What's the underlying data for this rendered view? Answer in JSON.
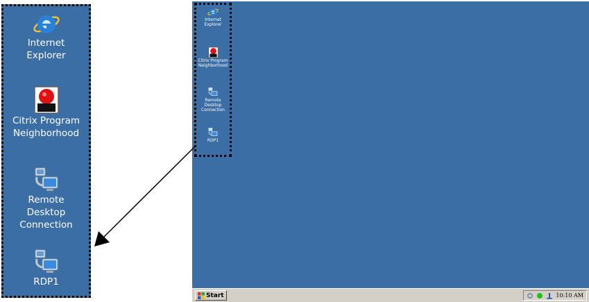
{
  "desktop_icons": [
    {
      "label_lines": [
        "Internet",
        "Explorer"
      ],
      "icon": "internet-explorer-icon"
    },
    {
      "label_lines": [
        "Citrix Program",
        "Neighborhood"
      ],
      "icon": "citrix-program-neighborhood-icon"
    },
    {
      "label_lines": [
        "Remote",
        "Desktop",
        "Connection"
      ],
      "icon": "remote-desktop-connection-icon"
    },
    {
      "label_lines": [
        "RDP1"
      ],
      "icon": "rdp1-icon"
    }
  ],
  "taskbar": {
    "start_label": "Start",
    "clock": "10:10 AM",
    "tray_icons": [
      "citrix-tray-icon",
      "network-status-icon",
      "volume-icon"
    ]
  },
  "colors": {
    "desktop_background": "#3a6ea5",
    "taskbar": "#d4d0c8",
    "selection_border": "#000000"
  }
}
